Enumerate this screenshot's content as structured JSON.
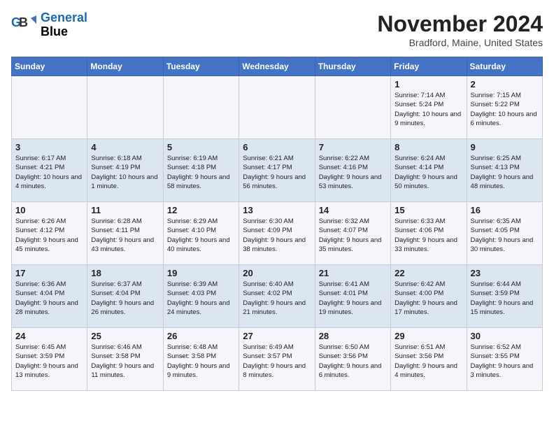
{
  "logo": {
    "line1": "General",
    "line2": "Blue"
  },
  "title": "November 2024",
  "subtitle": "Bradford, Maine, United States",
  "days_header": [
    "Sunday",
    "Monday",
    "Tuesday",
    "Wednesday",
    "Thursday",
    "Friday",
    "Saturday"
  ],
  "weeks": [
    [
      {
        "num": "",
        "info": ""
      },
      {
        "num": "",
        "info": ""
      },
      {
        "num": "",
        "info": ""
      },
      {
        "num": "",
        "info": ""
      },
      {
        "num": "",
        "info": ""
      },
      {
        "num": "1",
        "info": "Sunrise: 7:14 AM\nSunset: 5:24 PM\nDaylight: 10 hours and 9 minutes."
      },
      {
        "num": "2",
        "info": "Sunrise: 7:15 AM\nSunset: 5:22 PM\nDaylight: 10 hours and 6 minutes."
      }
    ],
    [
      {
        "num": "3",
        "info": "Sunrise: 6:17 AM\nSunset: 4:21 PM\nDaylight: 10 hours and 4 minutes."
      },
      {
        "num": "4",
        "info": "Sunrise: 6:18 AM\nSunset: 4:19 PM\nDaylight: 10 hours and 1 minute."
      },
      {
        "num": "5",
        "info": "Sunrise: 6:19 AM\nSunset: 4:18 PM\nDaylight: 9 hours and 58 minutes."
      },
      {
        "num": "6",
        "info": "Sunrise: 6:21 AM\nSunset: 4:17 PM\nDaylight: 9 hours and 56 minutes."
      },
      {
        "num": "7",
        "info": "Sunrise: 6:22 AM\nSunset: 4:16 PM\nDaylight: 9 hours and 53 minutes."
      },
      {
        "num": "8",
        "info": "Sunrise: 6:24 AM\nSunset: 4:14 PM\nDaylight: 9 hours and 50 minutes."
      },
      {
        "num": "9",
        "info": "Sunrise: 6:25 AM\nSunset: 4:13 PM\nDaylight: 9 hours and 48 minutes."
      }
    ],
    [
      {
        "num": "10",
        "info": "Sunrise: 6:26 AM\nSunset: 4:12 PM\nDaylight: 9 hours and 45 minutes."
      },
      {
        "num": "11",
        "info": "Sunrise: 6:28 AM\nSunset: 4:11 PM\nDaylight: 9 hours and 43 minutes."
      },
      {
        "num": "12",
        "info": "Sunrise: 6:29 AM\nSunset: 4:10 PM\nDaylight: 9 hours and 40 minutes."
      },
      {
        "num": "13",
        "info": "Sunrise: 6:30 AM\nSunset: 4:09 PM\nDaylight: 9 hours and 38 minutes."
      },
      {
        "num": "14",
        "info": "Sunrise: 6:32 AM\nSunset: 4:07 PM\nDaylight: 9 hours and 35 minutes."
      },
      {
        "num": "15",
        "info": "Sunrise: 6:33 AM\nSunset: 4:06 PM\nDaylight: 9 hours and 33 minutes."
      },
      {
        "num": "16",
        "info": "Sunrise: 6:35 AM\nSunset: 4:05 PM\nDaylight: 9 hours and 30 minutes."
      }
    ],
    [
      {
        "num": "17",
        "info": "Sunrise: 6:36 AM\nSunset: 4:04 PM\nDaylight: 9 hours and 28 minutes."
      },
      {
        "num": "18",
        "info": "Sunrise: 6:37 AM\nSunset: 4:04 PM\nDaylight: 9 hours and 26 minutes."
      },
      {
        "num": "19",
        "info": "Sunrise: 6:39 AM\nSunset: 4:03 PM\nDaylight: 9 hours and 24 minutes."
      },
      {
        "num": "20",
        "info": "Sunrise: 6:40 AM\nSunset: 4:02 PM\nDaylight: 9 hours and 21 minutes."
      },
      {
        "num": "21",
        "info": "Sunrise: 6:41 AM\nSunset: 4:01 PM\nDaylight: 9 hours and 19 minutes."
      },
      {
        "num": "22",
        "info": "Sunrise: 6:42 AM\nSunset: 4:00 PM\nDaylight: 9 hours and 17 minutes."
      },
      {
        "num": "23",
        "info": "Sunrise: 6:44 AM\nSunset: 3:59 PM\nDaylight: 9 hours and 15 minutes."
      }
    ],
    [
      {
        "num": "24",
        "info": "Sunrise: 6:45 AM\nSunset: 3:59 PM\nDaylight: 9 hours and 13 minutes."
      },
      {
        "num": "25",
        "info": "Sunrise: 6:46 AM\nSunset: 3:58 PM\nDaylight: 9 hours and 11 minutes."
      },
      {
        "num": "26",
        "info": "Sunrise: 6:48 AM\nSunset: 3:58 PM\nDaylight: 9 hours and 9 minutes."
      },
      {
        "num": "27",
        "info": "Sunrise: 6:49 AM\nSunset: 3:57 PM\nDaylight: 9 hours and 8 minutes."
      },
      {
        "num": "28",
        "info": "Sunrise: 6:50 AM\nSunset: 3:56 PM\nDaylight: 9 hours and 6 minutes."
      },
      {
        "num": "29",
        "info": "Sunrise: 6:51 AM\nSunset: 3:56 PM\nDaylight: 9 hours and 4 minutes."
      },
      {
        "num": "30",
        "info": "Sunrise: 6:52 AM\nSunset: 3:55 PM\nDaylight: 9 hours and 3 minutes."
      }
    ]
  ]
}
